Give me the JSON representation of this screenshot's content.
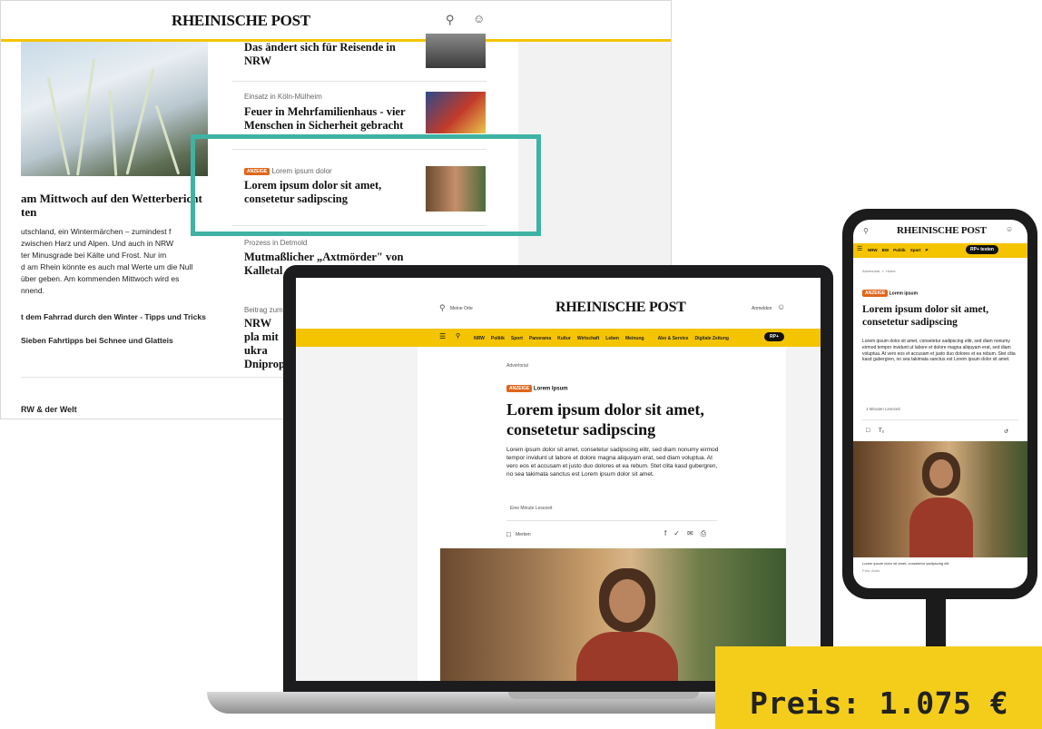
{
  "desktop": {
    "logo": "RHEINISCHE POST",
    "icons": [
      "location-pin-icon",
      "user-icon"
    ],
    "articles": [
      {
        "kicker": "",
        "title": "Das ändert sich für Reisende in NRW"
      },
      {
        "kicker": "Einsatz in Köln-Mülheim",
        "title": "Feuer in Mehrfamilienhaus - vier Menschen in Sicherheit gebracht"
      },
      {
        "badge": "ANZEIGE",
        "kicker": "Lorem ipsum dolor",
        "title": "Lorem ipsum dolor sit amet, consetetur sadipscing"
      },
      {
        "kicker": "Prozess in Detmold",
        "title": "Mutmaßlicher „Axtmörder\" von Kalletal a"
      },
      {
        "kicker": "Beitrag zum",
        "title": "NRW pla mit ukra Dniprop"
      }
    ],
    "lead_title": "am Mittwoch auf den Wetterbericht ten",
    "lead_body": "utschland, ein Wintermärchen – zumindest f\n zwischen Harz und Alpen. Und auch in NRW\nter Minusgrade bei Kälte und Frost. Nur im\nd am Rhein könnte es auch mal Werte um die Null\nüber geben. Am kommenden Mittwoch wird es\nnnend.",
    "links": [
      "t dem Fahrrad durch den Winter - Tipps und Tricks",
      "Sieben Fahrtipps bei Schnee und Glatteis"
    ],
    "section": "RW & der Welt"
  },
  "laptop": {
    "location": "Meine Orte",
    "logo": "RHEINISCHE POST",
    "login": "Anmelden",
    "nav": [
      "NRW",
      "Politik",
      "Sport",
      "Panorama",
      "Kultur",
      "Wirtschaft",
      "Leben",
      "Meinung",
      "Abo & Service",
      "Digitale Zeitung"
    ],
    "rp_plus": "RP+",
    "label": "Advertorial",
    "badge": "ANZEIGE",
    "kicker": "Lorem Ipsum",
    "headline": "Lorem ipsum dolor sit amet, consetetur sadipscing",
    "body": "Lorem ipsum dolor sit amet, consetetur sadipscing elitr, sed diam nonumy eirmod tempor invidunt ut labore et dolore magna aliquyam erat, sed diam voluptua. At vero eos et accusam et justo duo dolores et ea rebum. Stet clita kasd gubergren, no sea takimata sanctus est Lorem ipsum dolor sit amet.",
    "read_time": "Eine Minute Lesezeit",
    "bookmark": "Merken"
  },
  "phone": {
    "logo": "RHEINISCHE POST",
    "nav": [
      "NRW",
      "BW",
      "Politik",
      "Sport",
      "P"
    ],
    "rp_test": "RP+ testen",
    "breadcrumb": "Advertorial  >  Home",
    "badge": "ANZEIGE",
    "kicker": "Lorem ipsum",
    "headline": "Lorem ipsum dolor sit amet, consetetur sadipscing",
    "body": "Lorem ipsum dolor sit amet, consetetur sadipscing elitr, sed diam nonumy eirmod tempor invidunt ut labore et dolore magna aliquyam erat, sed diam voluptua. At vero eos et accusam et justo duo dolores et ea rebum. Stet clita kasd gubergren, no sea takimata sanctus est Lorem ipsum dolor sit amet.",
    "read_time": "1 Minuten Lesezeit",
    "caption": "Lorem ipsum dolor sit amet, consetetur sadipscing elit",
    "credit": "Foto: Autor"
  },
  "price": "Preis: 1.075 €",
  "colors": {
    "accent_yellow": "#f4c400",
    "teal": "#3fb3a3",
    "badge_orange": "#e0661a"
  }
}
